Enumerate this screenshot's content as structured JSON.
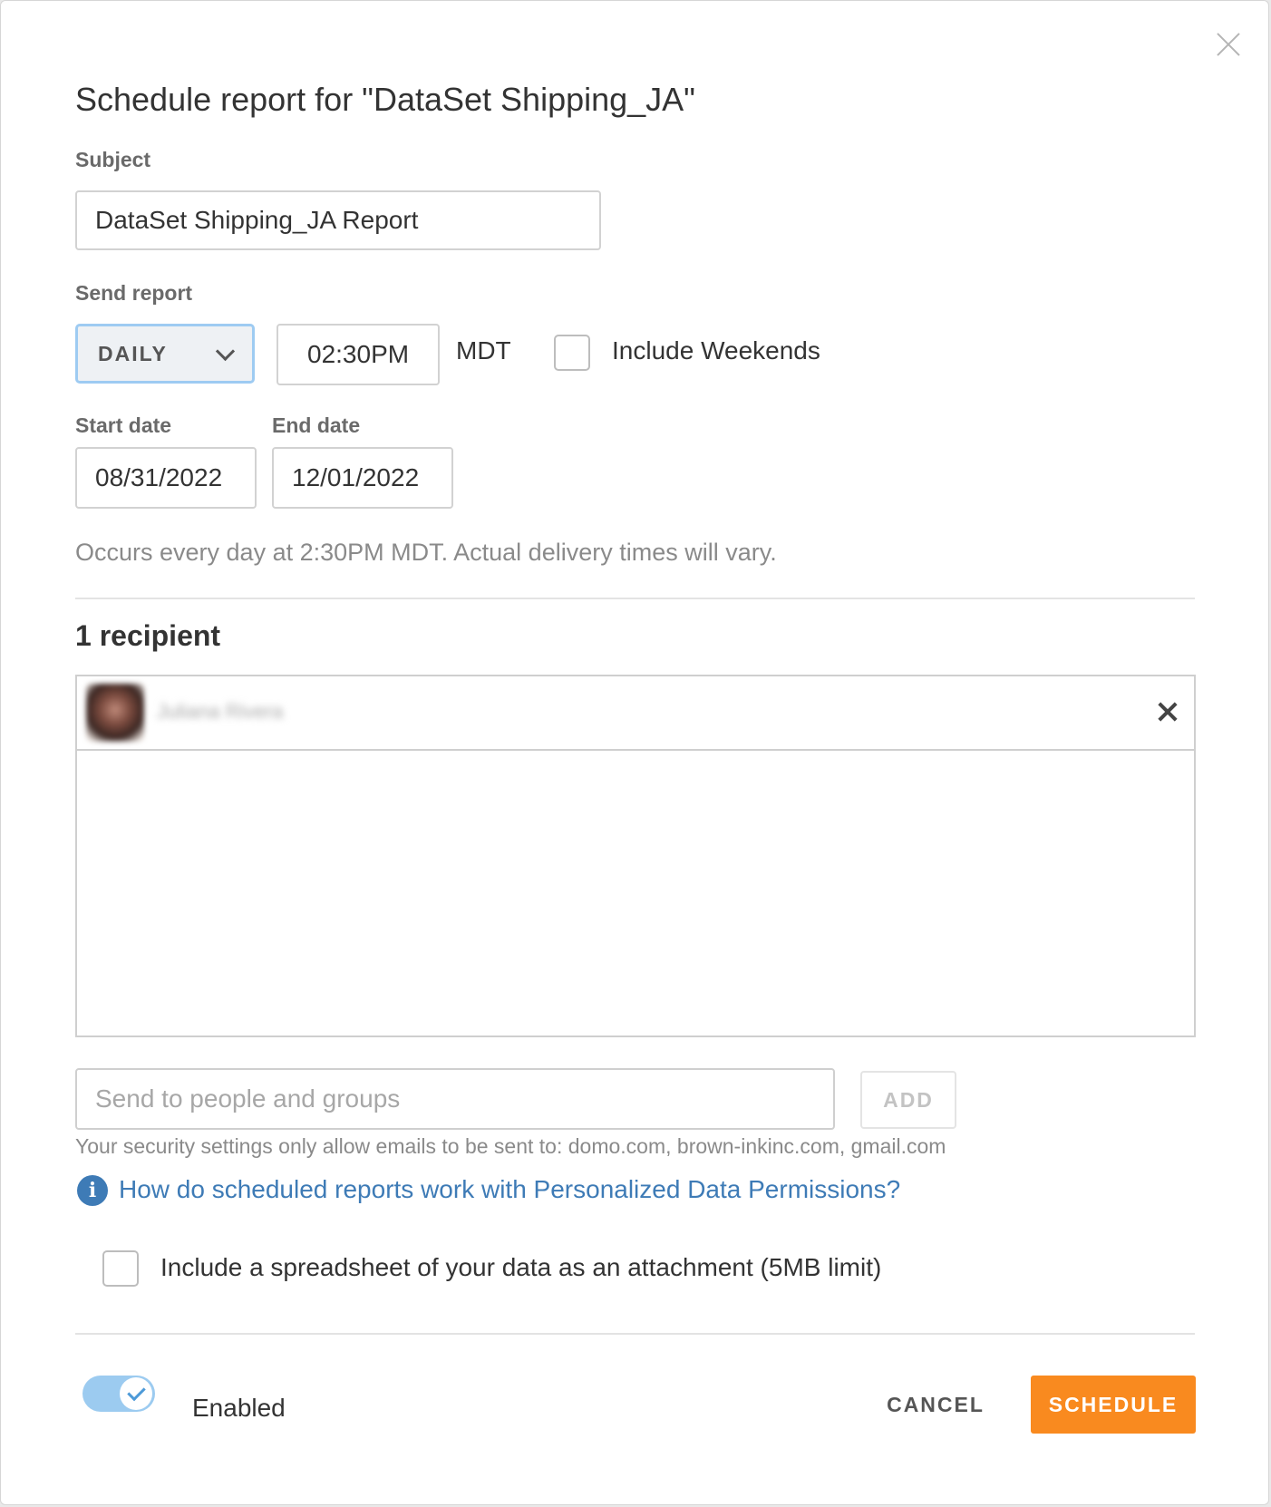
{
  "dialog": {
    "title": "Schedule report for \"DataSet Shipping_JA\"",
    "close_icon": "close-icon"
  },
  "subject": {
    "label": "Subject",
    "value": "DataSet Shipping_JA Report"
  },
  "send_report": {
    "label": "Send report",
    "frequency": "DAILY",
    "time": "02:30PM",
    "timezone": "MDT",
    "include_weekends_label": "Include Weekends",
    "include_weekends_checked": false
  },
  "dates": {
    "start_label": "Start date",
    "start_value": "08/31/2022",
    "end_label": "End date",
    "end_value": "12/01/2022"
  },
  "summary": "Occurs every day at 2:30PM MDT. Actual delivery times will vary.",
  "recipients": {
    "count_label": "1 recipient",
    "items": [
      {
        "name": "Juliana Rivera"
      }
    ]
  },
  "send_to": {
    "placeholder": "Send to people and groups",
    "add_label": "ADD",
    "security_note": "Your security settings only allow emails to be sent to: domo.com, brown-inkinc.com, gmail.com",
    "help_link": "How do scheduled reports work with Personalized Data Permissions?"
  },
  "attachment": {
    "label": "Include a spreadsheet of your data as an attachment (5MB limit)",
    "checked": false
  },
  "footer": {
    "enabled_label": "Enabled",
    "enabled": true,
    "cancel_label": "CANCEL",
    "schedule_label": "SCHEDULE"
  },
  "colors": {
    "accent": "#f98a1f",
    "link": "#3e7bb6",
    "toggle": "#9ccbf0",
    "select_border": "#9ecbf2"
  }
}
